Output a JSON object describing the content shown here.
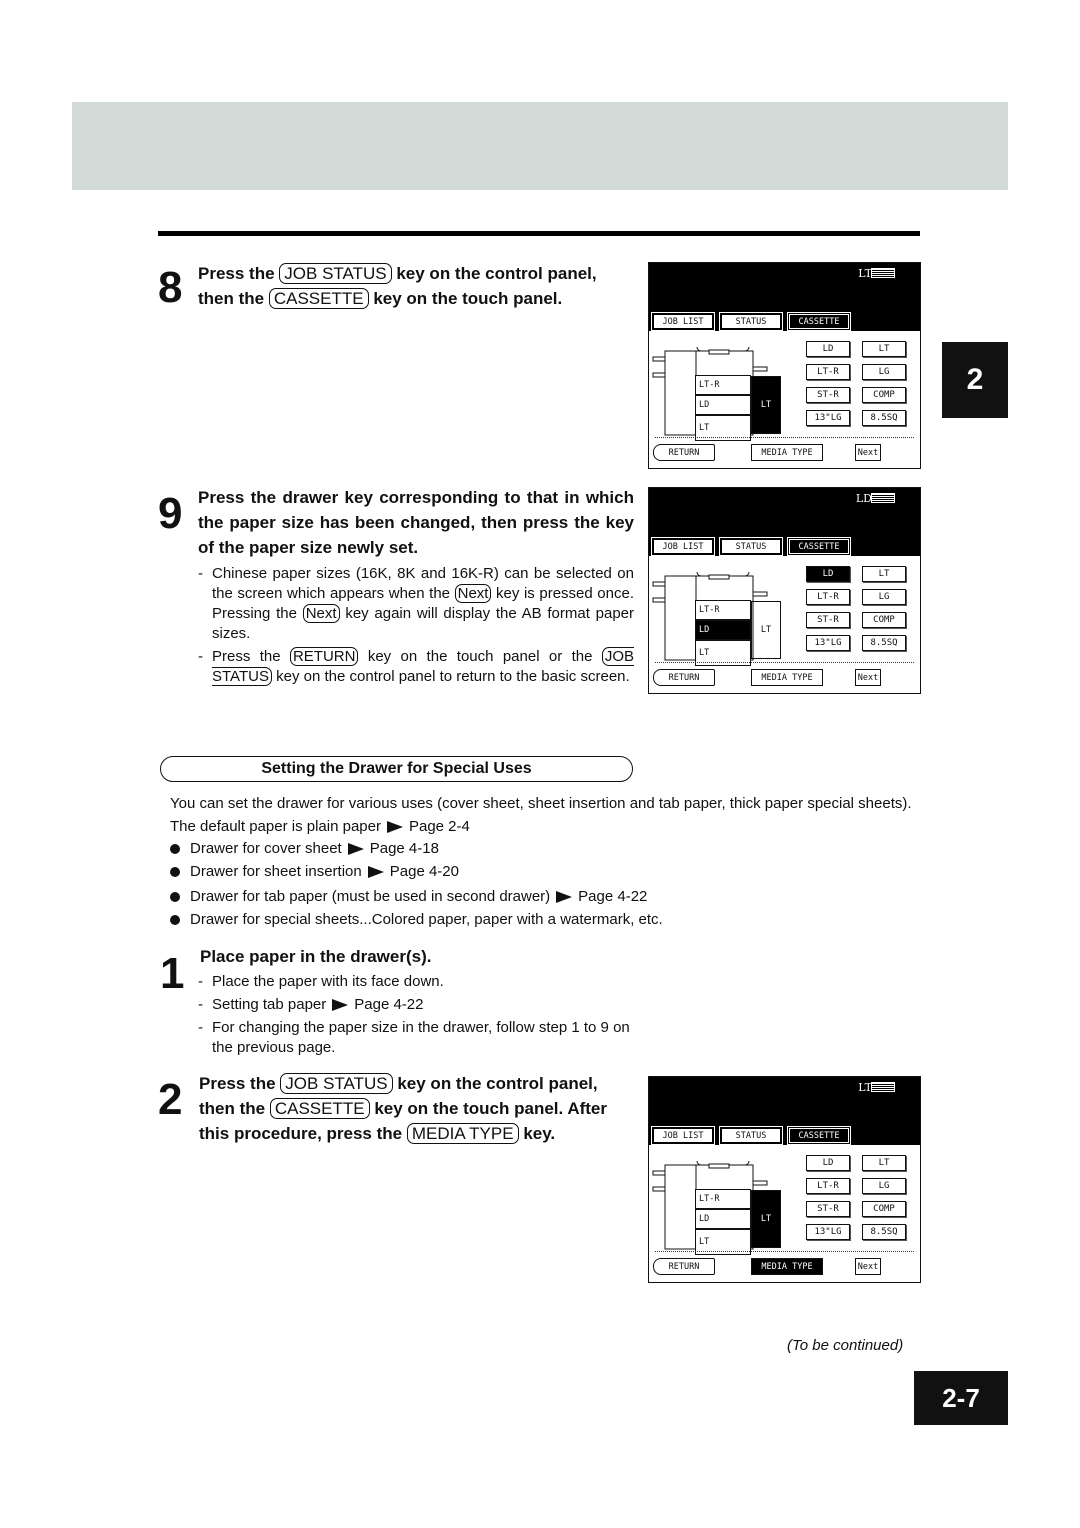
{
  "chapter_tab": "2",
  "page_number": "2-7",
  "step8": {
    "num": "8",
    "t1": "Press the",
    "k1": "JOB STATUS",
    "t2": "key on the control panel,",
    "t3": "then the",
    "k2": "CASSETTE",
    "t4": "key on the touch panel."
  },
  "step9": {
    "num": "9",
    "head": "Press the drawer key corresponding to that in which the paper size has been changed, then press the key of the paper size newly set.",
    "n1a": "Chinese paper sizes (16K, 8K and 16K-R) can be selected on the screen which appears when the",
    "n1k": "Next",
    "n1b": "key is pressed once. Pressing the",
    "n1k2": "Next",
    "n1c": "key again will display the AB format paper sizes.",
    "n2a": "Press the",
    "n2k": "RETURN",
    "n2b": "key on the touch panel or the",
    "n2k2": "JOB STATUS",
    "n2c": "key on the control panel to return to the basic screen."
  },
  "section": {
    "title": "Setting the Drawer for Special Uses",
    "intro": "You can set the drawer for various uses (cover sheet, sheet insertion and tab paper, thick paper special sheets). The default paper is plain paper",
    "intro_ref": "Page 2-4",
    "bullets": [
      {
        "text": "Drawer for cover sheet",
        "ref": "Page 4-18"
      },
      {
        "text": "Drawer for sheet insertion",
        "ref": "Page 4-20"
      },
      {
        "text": "Drawer for tab paper (must be used in second drawer)",
        "ref": "Page 4-22"
      },
      {
        "text": "Drawer for special sheets...Colored paper, paper with a watermark, etc.",
        "ref": ""
      }
    ]
  },
  "step1": {
    "num": "1",
    "head": "Place paper in the drawer(s).",
    "n1": "Place the paper with its face down.",
    "n2": "Setting tab paper",
    "n2ref": "Page 4-22",
    "n3": "For changing the paper size in the drawer, follow step 1 to 9 on the previous page."
  },
  "step2": {
    "num": "2",
    "t1": "Press the",
    "k1": "JOB STATUS",
    "t2": "key on the control panel,",
    "t3": "then the",
    "k2": "CASSETTE",
    "t4": "key on the touch panel. After",
    "t5": "this procedure, press the",
    "k3": "MEDIA TYPE",
    "t6": "key."
  },
  "continued": "(To be continued)",
  "panels": [
    {
      "size": "LT",
      "tabs": [
        "JOB LIST",
        "STATUS",
        "CASSETTE"
      ],
      "active_tab": 2,
      "sizes": [
        "LD",
        "LT",
        "LT-R",
        "LG",
        "ST-R",
        "COMP",
        "13\"LG",
        "8.5SQ"
      ],
      "selected_size": "",
      "drawers": [
        "LT-R",
        "LD",
        "LT"
      ],
      "selected_drawer": "",
      "side": "LT",
      "side_selected": true,
      "bottom": [
        "RETURN",
        "MEDIA TYPE",
        "Next"
      ],
      "bottom_selected": ""
    },
    {
      "size": "LD",
      "tabs": [
        "JOB LIST",
        "STATUS",
        "CASSETTE"
      ],
      "active_tab": 2,
      "sizes": [
        "LD",
        "LT",
        "LT-R",
        "LG",
        "ST-R",
        "COMP",
        "13\"LG",
        "8.5SQ"
      ],
      "selected_size": "LD",
      "drawers": [
        "LT-R",
        "LD",
        "LT"
      ],
      "selected_drawer": "LD",
      "side": "LT",
      "side_selected": false,
      "bottom": [
        "RETURN",
        "MEDIA TYPE",
        "Next"
      ],
      "bottom_selected": ""
    },
    {
      "size": "LT",
      "tabs": [
        "JOB LIST",
        "STATUS",
        "CASSETTE"
      ],
      "active_tab": 2,
      "sizes": [
        "LD",
        "LT",
        "LT-R",
        "LG",
        "ST-R",
        "COMP",
        "13\"LG",
        "8.5SQ"
      ],
      "selected_size": "",
      "drawers": [
        "LT-R",
        "LD",
        "LT"
      ],
      "selected_drawer": "",
      "side": "LT",
      "side_selected": true,
      "bottom": [
        "RETURN",
        "MEDIA TYPE",
        "Next"
      ],
      "bottom_selected": "MEDIA TYPE"
    }
  ]
}
